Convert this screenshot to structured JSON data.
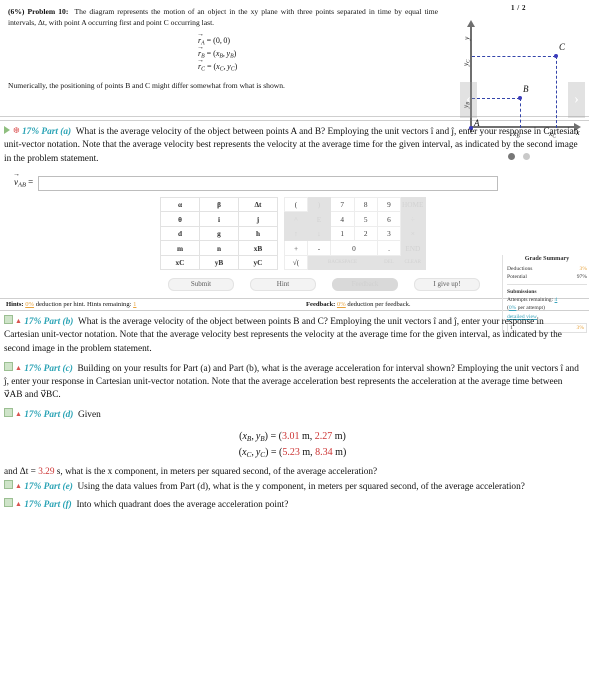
{
  "problem": {
    "title": "(6%) Problem 10:",
    "statement": "The diagram represents the motion of an object in the xy plane with three points separated in time by equal time intervals, Δt, with point A occurring first and point C occurring last.",
    "equations": [
      "r⃗A = (0, 0)",
      "r⃗B = (xB, yB)",
      "r⃗C = (xC, yC)"
    ],
    "note": "Numerically, the positioning of points B and C might differ somewhat from what is shown."
  },
  "figure": {
    "page_indicator": "1 / 2",
    "axis_x_label": "x",
    "axis_y_label": "y",
    "point_labels": [
      "A",
      "B",
      "C"
    ],
    "tick_labels": [
      "xB",
      "xC",
      "yB",
      "yC"
    ],
    "prev_arrow": "‹",
    "next_arrow": "›",
    "dots": [
      "active",
      "inactive"
    ]
  },
  "parts": {
    "a": {
      "pct": "17%",
      "label": "Part (a)",
      "text": "What is the average velocity of the object between points A and B? Employing the unit vectors î and ĵ, enter your response in Cartesian unit-vector notation. Note that the average velocity best represents the velocity at the average time for the given interval, as indicated by the second image in the problem statement."
    },
    "b": {
      "pct": "17%",
      "label": "Part (b)",
      "text": "What is the average velocity of the object between points B and C? Employing the unit vectors î and ĵ, enter your response in Cartesian unit-vector notation. Note that the average velocity best represents the velocity at the average time for the given interval, as indicated by the second image in the problem statement."
    },
    "c": {
      "pct": "17%",
      "label": "Part (c)",
      "text": "Building on your results for Part (a) and Part (b), what is the average acceleration for interval shown? Employing the unit vectors î and ĵ, enter your response in Cartesian unit-vector notation. Note that the average acceleration best represents the acceleration at the average time between v⃗AB and v⃗BC."
    },
    "d": {
      "pct": "17%",
      "label": "Part (d)",
      "text": "Given",
      "eq_b_prefix": "(xB, yB) = (",
      "eq_b_x": "3.01",
      "eq_b_xunit": " m, ",
      "eq_b_y": "2.27",
      "eq_b_yunit": " m)",
      "eq_c_prefix": "(xC, yC) = (",
      "eq_c_x": "5.23",
      "eq_c_xunit": " m, ",
      "eq_c_y": "8.34",
      "eq_c_yunit": " m)",
      "tail_prefix": "and Δt = ",
      "tail_dt": "3.29",
      "tail_text": " s, what is the x component, in meters per squared second, of the average acceleration?"
    },
    "e": {
      "pct": "17%",
      "label": "Part (e)",
      "text": "Using the data values from Part (d), what is the y component, in meters per squared second, of the average acceleration?"
    },
    "f": {
      "pct": "17%",
      "label": "Part (f)",
      "text": "Into which quadrant does the average acceleration point?"
    }
  },
  "answer": {
    "label": "v⃗AB =",
    "value": "",
    "placeholder": ""
  },
  "keypad": {
    "left_rows": [
      [
        "α",
        "β",
        "Δt"
      ],
      [
        "θ",
        "i",
        "j"
      ],
      [
        "d",
        "g",
        "h"
      ],
      [
        "m",
        "n",
        "xB"
      ],
      [
        "xC",
        "yB",
        "yC"
      ]
    ],
    "right_rows": [
      [
        {
          "label": "(",
          "style": "plain"
        },
        {
          "label": ")",
          "style": "gray"
        },
        {
          "label": "7",
          "style": "plain"
        },
        {
          "label": "8",
          "style": "plain"
        },
        {
          "label": "9",
          "style": "plain"
        },
        {
          "label": "HOME",
          "style": "gray"
        }
      ],
      [
        {
          "label": "^",
          "style": "gray"
        },
        {
          "label": "E",
          "style": "gray"
        },
        {
          "label": "4",
          "style": "plain"
        },
        {
          "label": "5",
          "style": "plain"
        },
        {
          "label": "6",
          "style": "plain"
        },
        {
          "label": "÷",
          "style": "gray"
        }
      ],
      [
        {
          "label": "↑",
          "style": "gray"
        },
        {
          "label": "↓",
          "style": "gray"
        },
        {
          "label": "1",
          "style": "plain"
        },
        {
          "label": "2",
          "style": "plain"
        },
        {
          "label": "3",
          "style": "plain"
        },
        {
          "label": "×",
          "style": "gray"
        }
      ],
      [
        {
          "label": "+",
          "style": "plain"
        },
        {
          "label": "-",
          "style": "plain"
        },
        {
          "label": "0",
          "style": "plain",
          "wide": true
        },
        {
          "label": ".",
          "style": "plain"
        },
        {
          "label": "END",
          "style": "gray"
        }
      ],
      [
        {
          "label": "√(",
          "style": "plain"
        },
        {
          "label": "BACKSPACE",
          "style": "gray",
          "xwide": true
        },
        {
          "label": "DEL",
          "style": "gray"
        },
        {
          "label": "CLEAR",
          "style": "gray"
        }
      ]
    ]
  },
  "actions": {
    "submit": "Submit",
    "hint": "Hint",
    "feedback": "Feedback",
    "give_up": "I give up!"
  },
  "hintbar": {
    "hints_label": "Hints:",
    "hints_pct": "0%",
    "hints_text": "deduction per hint. Hints remaining:",
    "hints_remaining": "1",
    "feedback_label": "Feedback:",
    "feedback_pct": "0%",
    "feedback_text": "deduction per feedback."
  },
  "grade_summary": {
    "title": "Grade Summary",
    "deductions_label": "Deductions",
    "deductions_value": "3%",
    "potential_label": "Potential",
    "potential_value": "97%",
    "submissions_title": "Submissions",
    "attempts_label": "Attempts remaining:",
    "attempts_value": "4",
    "per_attempt_pct": "0%",
    "per_attempt_text": "per attempt)",
    "per_attempt_open": "(",
    "detailed_view": "detailed view",
    "row_index": "1",
    "row_value": "3%"
  },
  "colors": {
    "accent": "#2aa3b5",
    "value_red": "#cc3333",
    "orange": "#e8a33d",
    "point": "#3b3bbb"
  }
}
